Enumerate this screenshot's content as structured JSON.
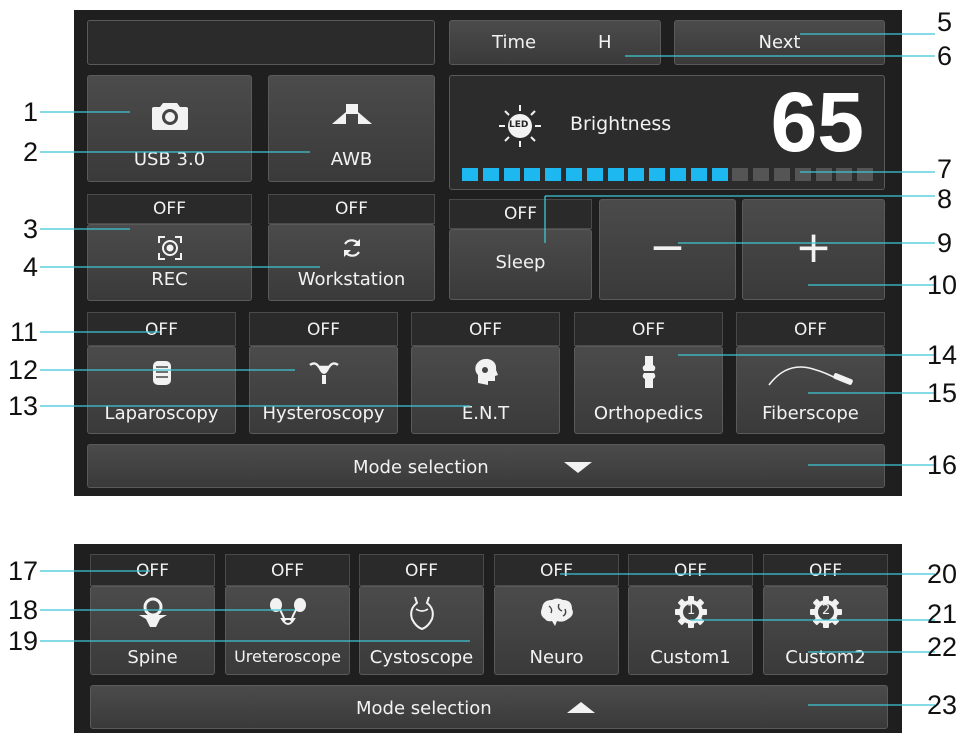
{
  "top": {
    "time_label": "Time",
    "time_value": "H",
    "next_label": "Next",
    "usb_label": "USB 3.0",
    "awb_label": "AWB",
    "rec_status": "OFF",
    "rec_label": "REC",
    "workstation_status": "OFF",
    "workstation_label": "Workstation",
    "sleep_status": "OFF",
    "sleep_label": "Sleep",
    "brightness_label": "Brightness",
    "led_icon_text": "LED",
    "brightness_value": "65",
    "brightness_level": {
      "filled": 13,
      "total": 20
    },
    "minus_symbol": "−",
    "plus_symbol": "+",
    "modes": [
      {
        "status": "OFF",
        "label": "Laparoscopy",
        "icon": "intestine-icon"
      },
      {
        "status": "OFF",
        "label": "Hysteroscopy",
        "icon": "uterus-icon"
      },
      {
        "status": "OFF",
        "label": "E.N.T",
        "icon": "head-profile-icon"
      },
      {
        "status": "OFF",
        "label": "Orthopedics",
        "icon": "knee-joint-icon"
      },
      {
        "status": "OFF",
        "label": "Fiberscope",
        "icon": "fiberscope-icon"
      }
    ],
    "mode_selection_label": "Mode selection"
  },
  "bottom": {
    "modes": [
      {
        "status": "OFF",
        "label": "Spine",
        "icon": "vertebra-icon"
      },
      {
        "status": "OFF",
        "label": "Ureteroscope",
        "icon": "kidney-icon"
      },
      {
        "status": "OFF",
        "label": "Cystoscope",
        "icon": "bladder-icon"
      },
      {
        "status": "OFF",
        "label": "Neuro",
        "icon": "brain-icon"
      },
      {
        "status": "OFF",
        "label": "Custom1",
        "icon": "gear-1-icon",
        "gear_text": "1"
      },
      {
        "status": "OFF",
        "label": "Custom2",
        "icon": "gear-2-icon",
        "gear_text": "2"
      }
    ],
    "mode_selection_label": "Mode selection"
  },
  "callouts": [
    "1",
    "2",
    "3",
    "4",
    "5",
    "6",
    "7",
    "8",
    "9",
    "10",
    "11",
    "12",
    "13",
    "14",
    "15",
    "16",
    "17",
    "18",
    "19",
    "20",
    "21",
    "22",
    "23"
  ],
  "colors": {
    "panel_bg": "#1f1f1f",
    "button_bg": "#444444",
    "leader_line": "#3ec8d6",
    "brightness_on": "#1eb8f0",
    "brightness_off": "#555555",
    "text": "#f2f2f2"
  }
}
